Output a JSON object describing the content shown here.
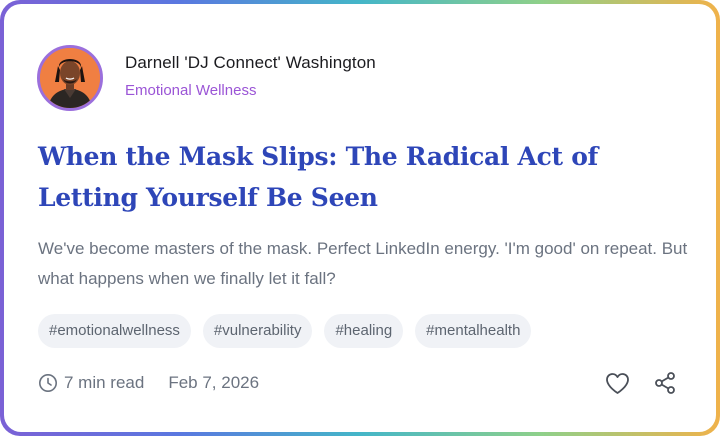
{
  "author": {
    "name": "Darnell 'DJ Connect' Washington",
    "category": "Emotional Wellness"
  },
  "post": {
    "title": "When the Mask Slips: The Radical Act of Letting Yourself Be Seen",
    "excerpt": "We've become masters of the mask. Perfect LinkedIn energy. 'I'm good' on repeat. But what happens when we finally let it fall?",
    "tags": [
      "#emotionalwellness",
      "#vulnerability",
      "#healing",
      "#mentalhealth"
    ],
    "read_time": "7 min read",
    "date": "Feb 7, 2026"
  },
  "icons": {
    "clock": "clock-icon",
    "like": "heart-icon",
    "share": "share-icon"
  },
  "colors": {
    "title": "#2e46b8",
    "category": "#9b55d6",
    "avatar_bg": "#f07f42",
    "avatar_ring": "#9b6fdc"
  }
}
